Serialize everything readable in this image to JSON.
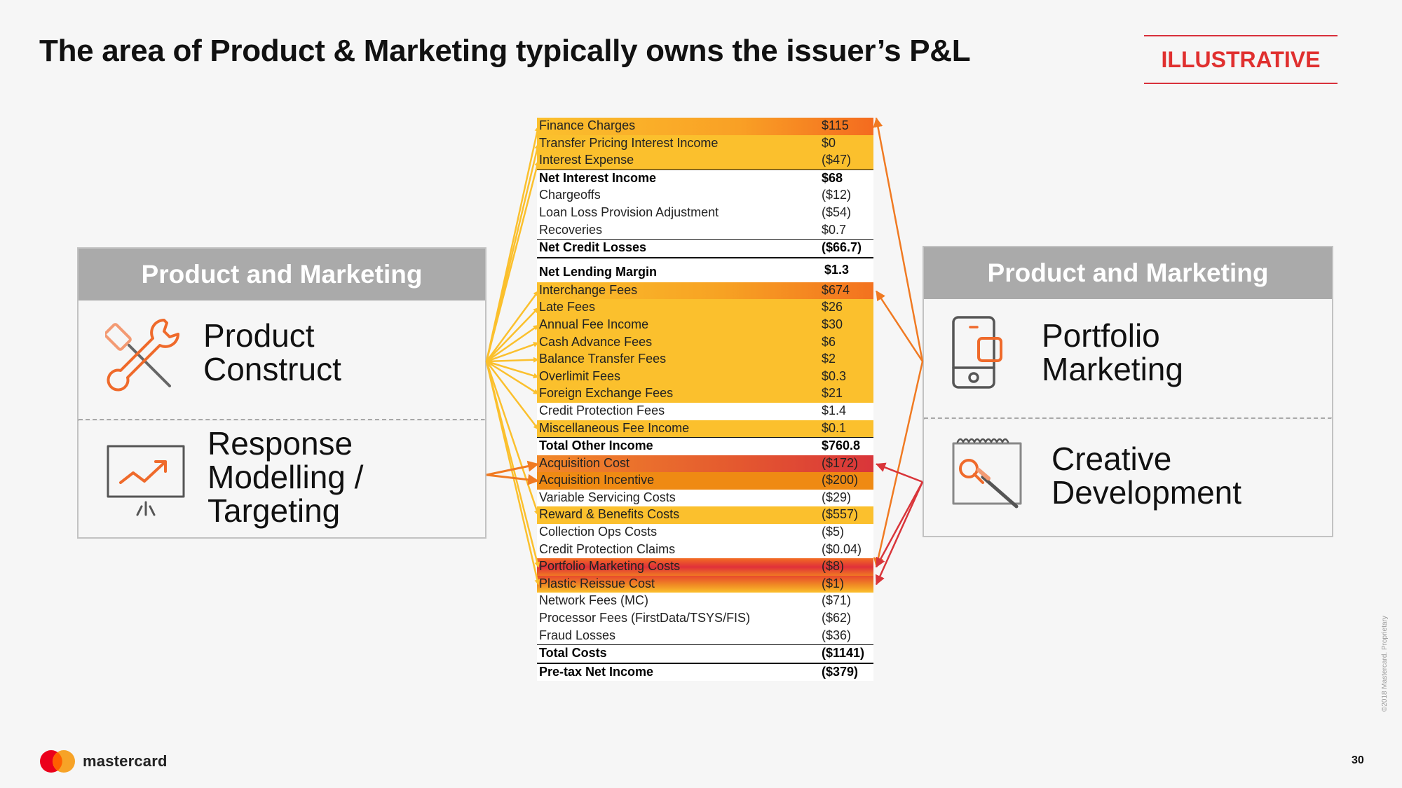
{
  "title": "The area of Product & Marketing typically owns the issuer’s P&L",
  "badge": "ILLUSTRATIVE",
  "left_panel": {
    "header": "Product and Marketing",
    "sections": [
      {
        "label": "Product\nConstruct",
        "icon": "wrench-screwdriver-icon"
      },
      {
        "label": "Response\nModelling /\nTargeting",
        "icon": "presentation-chart-icon"
      }
    ]
  },
  "right_panel": {
    "header": "Product and Marketing",
    "sections": [
      {
        "label": "Portfolio\nMarketing",
        "icon": "mobile-phone-icon"
      },
      {
        "label": "Creative\nDevelopment",
        "icon": "creative-brush-icon"
      }
    ]
  },
  "pl_table": {
    "rows": [
      {
        "label": "Finance Charges",
        "value": "$115"
      },
      {
        "label": "Transfer Pricing Interest Income",
        "value": "$0"
      },
      {
        "label": "Interest Expense",
        "value": "($47)"
      },
      {
        "label": "Net Interest Income",
        "value": "$68"
      },
      {
        "label": "Chargeoffs",
        "value": "($12)"
      },
      {
        "label": "Loan Loss Provision Adjustment",
        "value": "($54)"
      },
      {
        "label": "Recoveries",
        "value": "$0.7"
      },
      {
        "label": "Net Credit Losses",
        "value": "($66.7)"
      },
      {
        "label": "Net Lending Margin",
        "value": "$1.3"
      },
      {
        "label": "Interchange Fees",
        "value": "$674"
      },
      {
        "label": "Late Fees",
        "value": "$26"
      },
      {
        "label": "Annual Fee Income",
        "value": "$30"
      },
      {
        "label": "Cash Advance Fees",
        "value": "$6"
      },
      {
        "label": "Balance Transfer Fees",
        "value": "$2"
      },
      {
        "label": "Overlimit Fees",
        "value": "$0.3"
      },
      {
        "label": "Foreign Exchange Fees",
        "value": "$21"
      },
      {
        "label": "Credit Protection Fees",
        "value": "$1.4"
      },
      {
        "label": "Miscellaneous Fee Income",
        "value": "$0.1"
      },
      {
        "label": "Total Other Income",
        "value": "$760.8"
      },
      {
        "label": "Acquisition Cost",
        "value": "($172)"
      },
      {
        "label": "Acquisition Incentive",
        "value": "($200)"
      },
      {
        "label": "Variable Servicing Costs",
        "value": "($29)"
      },
      {
        "label": "Reward & Benefits Costs",
        "value": "($557)"
      },
      {
        "label": "Collection Ops Costs",
        "value": "($5)"
      },
      {
        "label": "Credit Protection Claims",
        "value": "($0.04)"
      },
      {
        "label": "Portfolio Marketing Costs",
        "value": "($8)"
      },
      {
        "label": "Plastic Reissue Cost",
        "value": "($1)"
      },
      {
        "label": "Network Fees (MC)",
        "value": "($71)"
      },
      {
        "label": "Processor Fees (FirstData/TSYS/FIS)",
        "value": "($62)"
      },
      {
        "label": "Fraud Losses",
        "value": "($36)"
      },
      {
        "label": "Total Costs",
        "value": "($1141)"
      },
      {
        "label": "Pre-tax Net Income",
        "value": "($379)"
      }
    ]
  },
  "colors": {
    "highlight_yellow": "#fbc02d",
    "highlight_orange": "#ef8a13",
    "highlight_red": "#d9353a",
    "badge_red": "#e0302f",
    "panel_header_gray": "#aaaaaa"
  },
  "footer": {
    "logo_text": "mastercard",
    "page_number": "30",
    "copyright": "©2018 Mastercard. Proprietary"
  }
}
